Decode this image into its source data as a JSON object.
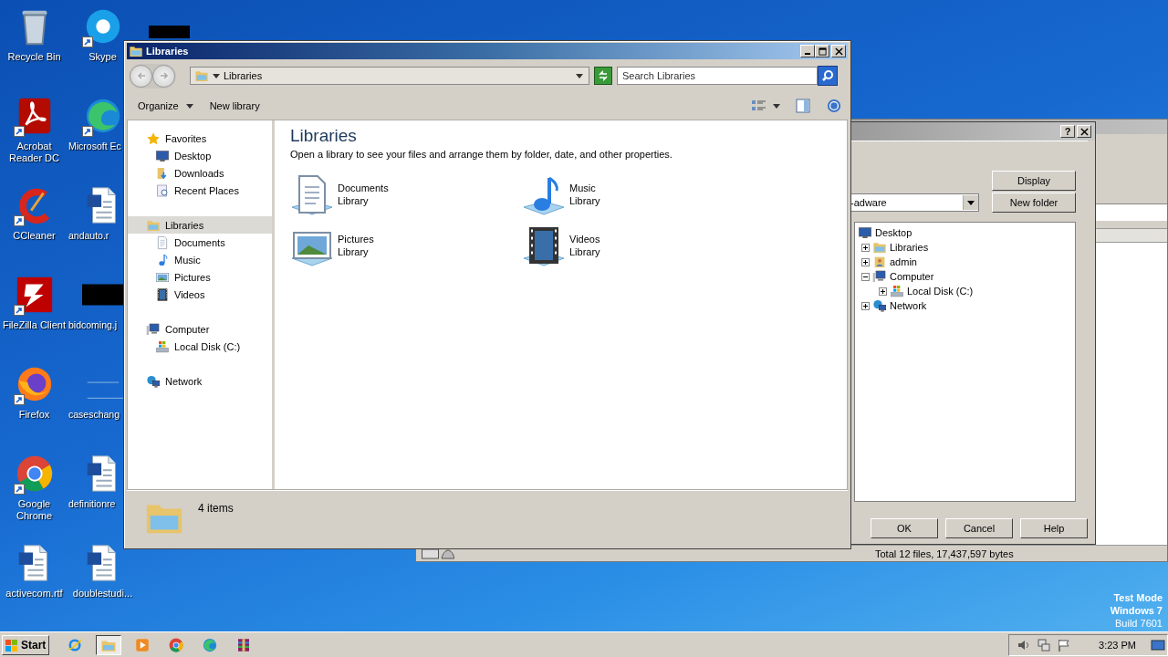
{
  "desktop": {
    "icons": [
      {
        "label": "Recycle Bin",
        "kind": "recycle",
        "shortcut": false
      },
      {
        "label": "Acrobat Reader DC",
        "kind": "acrobat",
        "shortcut": true
      },
      {
        "label": "CCleaner",
        "kind": "ccleaner",
        "shortcut": true
      },
      {
        "label": "FileZilla Client",
        "kind": "filezilla",
        "shortcut": true
      },
      {
        "label": "Firefox",
        "kind": "firefox",
        "shortcut": true
      },
      {
        "label": "Google Chrome",
        "kind": "chrome",
        "shortcut": true
      },
      {
        "label": "activecom.rtf",
        "kind": "word",
        "shortcut": false
      },
      {
        "label": "Skype",
        "kind": "skype",
        "shortcut": true
      },
      {
        "label": "Microsoft Ec",
        "kind": "edge",
        "shortcut": true
      },
      {
        "label": "andauto.r",
        "kind": "word",
        "shortcut": false
      },
      {
        "label": "bidcoming.j",
        "kind": "redacted",
        "shortcut": false
      },
      {
        "label": "caseschang",
        "kind": "blank",
        "shortcut": false
      },
      {
        "label": "definitionre",
        "kind": "word",
        "shortcut": false
      },
      {
        "label": "doublestudi...",
        "kind": "word",
        "shortcut": false
      }
    ],
    "os_notice": [
      "Test Mode",
      "Windows 7",
      "Build 7601"
    ]
  },
  "background_window": {
    "status": "Total 12 files, 17,437,597 bytes"
  },
  "dialog": {
    "help_glyph": "?",
    "folder_combo": "-adware",
    "side_buttons": [
      "Display",
      "New folder"
    ],
    "tree": {
      "label": "Desktop",
      "kind": "desktop",
      "children": [
        {
          "label": "Libraries",
          "kind": "library",
          "expanded": false
        },
        {
          "label": "admin",
          "kind": "user",
          "expanded": false
        },
        {
          "label": "Computer",
          "kind": "computer",
          "expanded": true,
          "children": [
            {
              "label": "Local Disk (C:)",
              "kind": "disk",
              "expanded": false
            }
          ]
        },
        {
          "label": "Network",
          "kind": "network",
          "expanded": false
        }
      ]
    },
    "buttons": [
      "OK",
      "Cancel",
      "Help"
    ]
  },
  "explorer": {
    "title": "Libraries",
    "address": "Libraries",
    "search": {
      "placeholder": "Search Libraries"
    },
    "toolbar": [
      {
        "label": "Organize",
        "menu": true
      },
      {
        "label": "New library",
        "menu": false
      }
    ],
    "nav": [
      {
        "label": "Favorites",
        "kind": "star",
        "selected": false,
        "children": [
          {
            "label": "Desktop",
            "kind": "desktop",
            "selected": false
          },
          {
            "label": "Downloads",
            "kind": "downloads",
            "selected": false
          },
          {
            "label": "Recent Places",
            "kind": "recent",
            "selected": false
          }
        ]
      },
      {
        "label": "Libraries",
        "kind": "library",
        "selected": true,
        "children": [
          {
            "label": "Documents",
            "kind": "documents",
            "selected": false
          },
          {
            "label": "Music",
            "kind": "music",
            "selected": false
          },
          {
            "label": "Pictures",
            "kind": "pictures",
            "selected": false
          },
          {
            "label": "Videos",
            "kind": "videos",
            "selected": false
          }
        ]
      },
      {
        "label": "Computer",
        "kind": "computer",
        "selected": false,
        "children": [
          {
            "label": "Local Disk (C:)",
            "kind": "disk",
            "selected": false
          }
        ]
      },
      {
        "label": "Network",
        "kind": "network",
        "selected": false
      }
    ],
    "content": {
      "heading": "Libraries",
      "description": "Open a library to see your files and arrange them by folder, date, and other properties.",
      "libraries": [
        {
          "name": "Documents",
          "sub": "Library",
          "kind": "documents"
        },
        {
          "name": "Music",
          "sub": "Library",
          "kind": "music"
        },
        {
          "name": "Pictures",
          "sub": "Library",
          "kind": "pictures"
        },
        {
          "name": "Videos",
          "sub": "Library",
          "kind": "videos"
        }
      ]
    },
    "details": {
      "count": "4 items"
    }
  },
  "taskbar": {
    "start": "Start",
    "apps": [
      {
        "kind": "ie",
        "selected": false
      },
      {
        "kind": "explorer",
        "selected": true
      },
      {
        "kind": "media",
        "selected": false
      },
      {
        "kind": "chrome",
        "selected": false
      },
      {
        "kind": "edge",
        "selected": false
      },
      {
        "kind": "winrar",
        "selected": false
      }
    ],
    "time": "3:23 PM"
  }
}
